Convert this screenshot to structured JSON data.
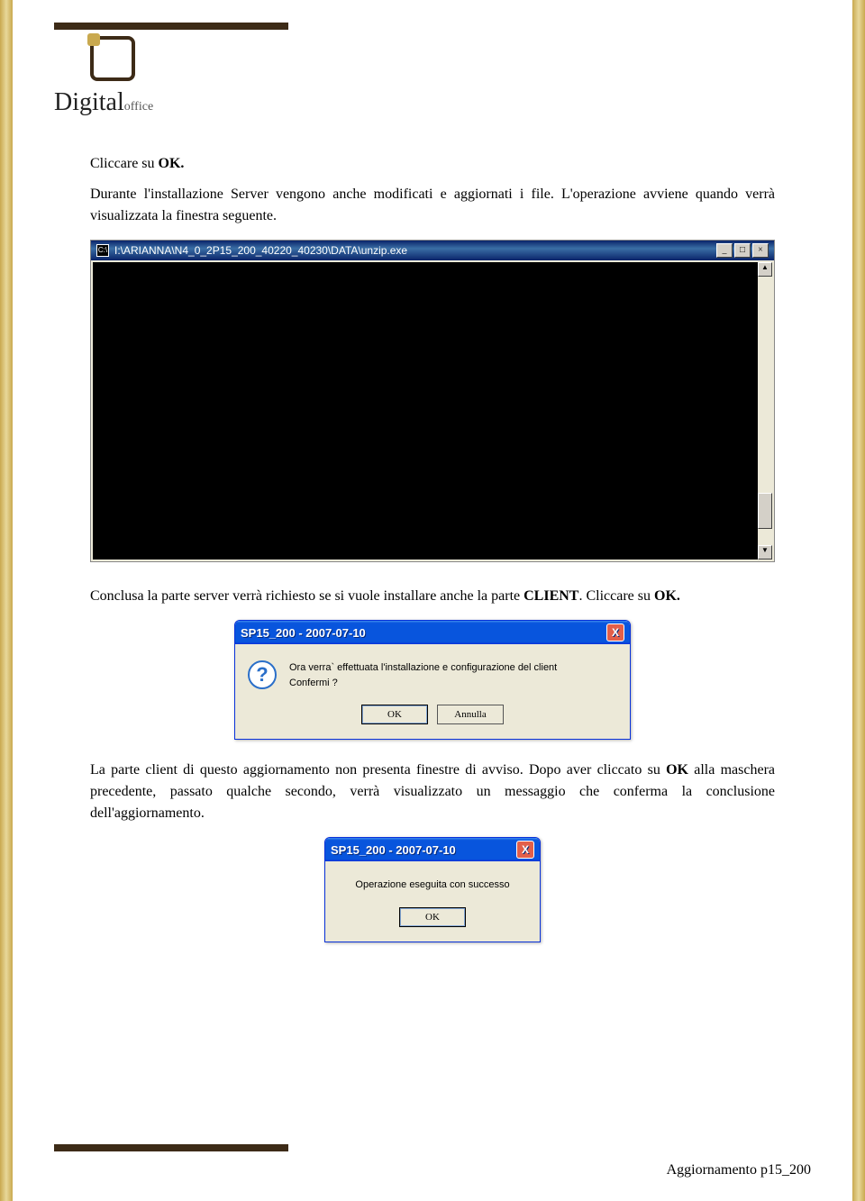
{
  "header": {
    "logo_main": "Digital",
    "logo_sub": "office"
  },
  "body": {
    "para1_a": "Cliccare su ",
    "para1_b": "OK.",
    "para2": "Durante l'installazione Server vengono anche modificati e aggiornati i file. L'operazione avviene quando verrà visualizzata la finestra seguente.",
    "para3_a": "Conclusa la parte server verrà richiesto se si vuole installare anche la parte ",
    "para3_b": "CLIENT",
    "para3_c": ". Cliccare su ",
    "para3_d": "OK.",
    "para4_a": "La parte client di questo aggiornamento non presenta finestre di avviso. Dopo aver cliccato su ",
    "para4_b": "OK",
    "para4_c": " alla maschera precedente, passato qualche secondo, verrà visualizzato un messaggio che conferma la conclusione dell'aggiornamento."
  },
  "cmd": {
    "title": "I:\\ARIANNA\\N4_0_2P15_200_40220_40230\\DATA\\unzip.exe",
    "icon_prefix": "C:\\",
    "min": "_",
    "max": "□",
    "close": "×",
    "up": "▲",
    "down": "▼"
  },
  "dialog1": {
    "title": "SP15_200 - 2007-07-10",
    "close": "X",
    "icon": "?",
    "line1": "Ora verra` effettuata l'installazione e configurazione del client",
    "line2": "Confermi ?",
    "ok": "OK",
    "cancel": "Annulla"
  },
  "dialog2": {
    "title": "SP15_200 - 2007-07-10",
    "close": "X",
    "msg": "Operazione eseguita con successo",
    "ok": "OK"
  },
  "footer": {
    "text": "Aggiornamento p15_200"
  }
}
